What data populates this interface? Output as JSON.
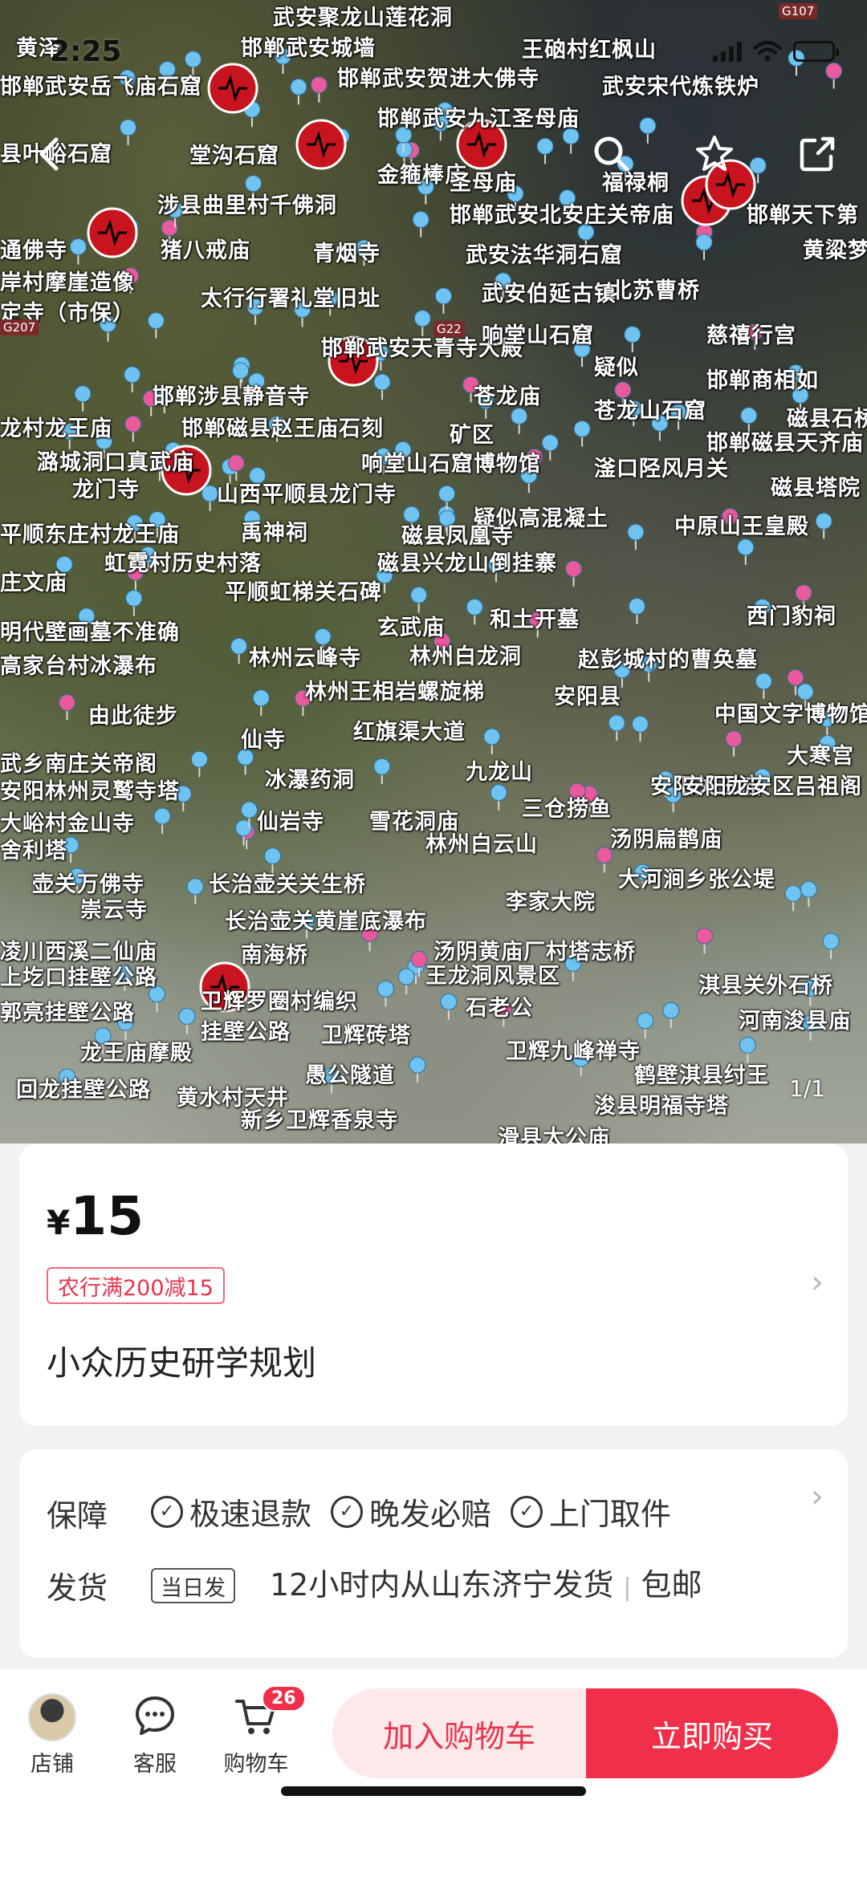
{
  "status_bar": {
    "time": "2:25"
  },
  "hero": {
    "page_counter": "1/1",
    "map_labels": [
      "武安聚龙山莲花洞",
      "王硇村红枫山",
      "邯郸武安城墙",
      "黄泽",
      "邯郸武安岳飞庙石窟",
      "邯郸武安贺进大佛寺",
      "武安宋代炼铁炉",
      "邯郸武安九江圣母庙",
      "县叶峪石窟",
      "堂沟石窟",
      "金箍棒庙",
      "圣母庙",
      "福禄桐",
      "涉县曲里村千佛洞",
      "邯郸武安北安庄关帝庙",
      "邯郸天下第",
      "通佛寺",
      "猪八戒庙",
      "青烟寺",
      "武安法华洞石窟",
      "黄粱梦",
      "岸村摩崖造像",
      "太行行署礼堂旧址",
      "武安伯延古镇",
      "北苏曹桥",
      "定寺（市保）",
      "邯郸武安天青寺大殿",
      "响堂山石窟",
      "慈禧行宫",
      "疑似",
      "邯郸商相如",
      "邯郸涉县静音寺",
      "苍龙庙",
      "苍龙山石窟",
      "磁县石桥",
      "龙村龙王庙",
      "邯郸磁县赵王庙石刻",
      "矿区",
      "邯郸磁县天齐庙",
      "潞城洞口真武庙",
      "响堂山石窟博物馆",
      "滏口陉风月关",
      "磁县塔院",
      "龙门寺",
      "山西平顺县龙门寺",
      "疑似高混凝土",
      "中原山王皇殿",
      "平顺东庄村龙王庙",
      "禹神祠",
      "磁县凤凰寺",
      "虹霓村历史村落",
      "磁县兴龙山倒挂寨",
      "庄文庙",
      "平顺虹梯关石碑",
      "西门豹祠",
      "明代壁画墓不准确",
      "玄武庙",
      "和土开墓",
      "高家台村冰瀑布",
      "林州云峰寺",
      "林州白龙洞",
      "赵彭城村的曹奂墓",
      "林州王相岩螺旋梯",
      "安阳县",
      "中国文字博物馆",
      "由此徒步",
      "仙寺",
      "红旗渠大道",
      "武乡南庄关帝阁",
      "冰瀑药洞",
      "九龙山",
      "大寒宫",
      "安阳林州灵鹫寺塔",
      "安阳关王庙",
      "安阳龙安区吕祖阁",
      "大峪村金山寺",
      "仙岩寺",
      "雪花洞庙",
      "三仓捞鱼",
      "林州白云山",
      "汤阴扁鹊庙",
      "舍利塔",
      "壶关万佛寺",
      "长治壶关关生桥",
      "大河涧乡张公堤",
      "李家大院",
      "崇云寺",
      "长治壶关黄崖底瀑布",
      "汤阴黄庙厂村塔志桥",
      "凌川西溪二仙庙",
      "南海桥",
      "王龙洞风景区",
      "上圪口挂壁公路",
      "卫辉罗圈村编织",
      "石老公",
      "淇县关外石桥",
      "郭亮挂壁公路",
      "挂壁公路",
      "卫辉砖塔",
      "卫辉九峰禅寺",
      "河南浚县庙",
      "龙王庙摩殿",
      "愚公隧道",
      "鹤壁淇县纣王",
      "回龙挂壁公路",
      "黄水村天井",
      "浚县明福寺塔",
      "新乡卫辉香泉寺",
      "滑县太公庙"
    ]
  },
  "product": {
    "currency": "¥",
    "price": "15",
    "promo": "农行满200减15",
    "title": "小众历史研学规划"
  },
  "service": {
    "guarantee_label": "保障",
    "guarantees": [
      "极速退款",
      "晚发必赔",
      "上门取件"
    ],
    "shipping_label": "发货",
    "shipping_badge": "当日发",
    "shipping_text": "12小时内从山东济宁发货",
    "shipping_extra": "包邮"
  },
  "bottom_bar": {
    "store": "店铺",
    "service": "客服",
    "cart": "购物车",
    "cart_count": "26",
    "add_to_cart": "加入购物车",
    "buy_now": "立即购买"
  },
  "colors": {
    "accent": "#f0304a",
    "accent_light": "#fde8ea",
    "promo_border": "#f06a7a"
  }
}
